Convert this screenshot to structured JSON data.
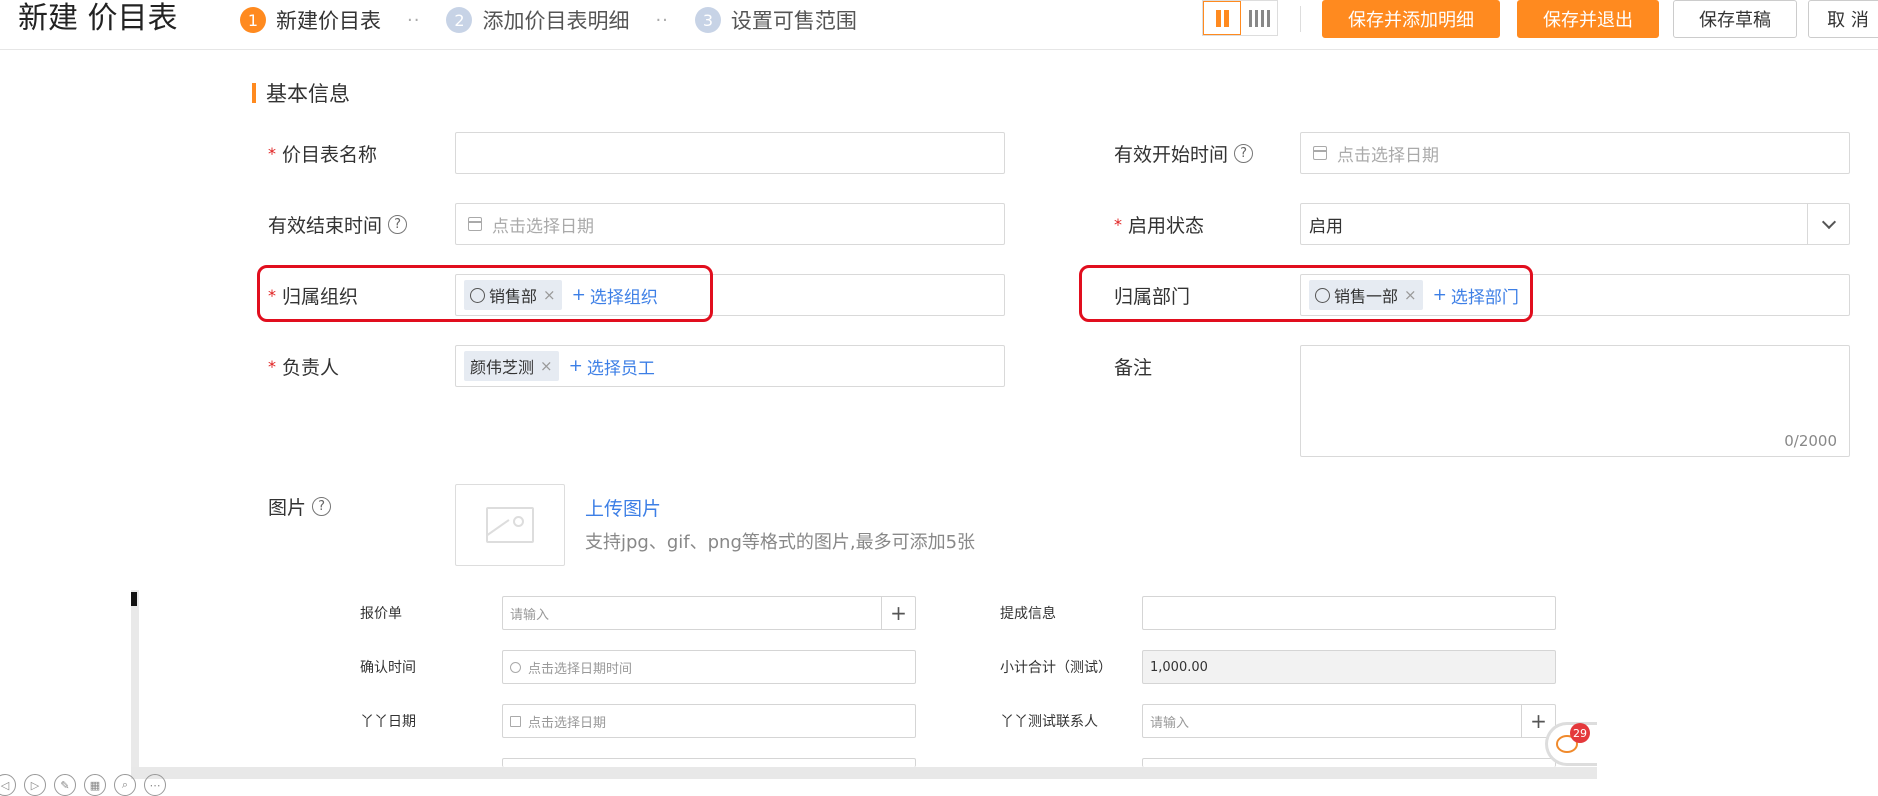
{
  "header": {
    "title": "新建 价目表",
    "steps": [
      {
        "num": "1",
        "label": "新建价目表"
      },
      {
        "num": "2",
        "label": "添加价目表明细"
      },
      {
        "num": "3",
        "label": "设置可售范围"
      }
    ],
    "step_sep": "··",
    "buttons": {
      "save_add_detail": "保存并添加明细",
      "save_exit": "保存并退出",
      "save_draft": "保存草稿",
      "cancel": "取 消"
    }
  },
  "section": {
    "title": "基本信息"
  },
  "form": {
    "name_label": "价目表名称",
    "start_label": "有效开始时间",
    "start_placeholder": "点击选择日期",
    "end_label": "有效结束时间",
    "end_placeholder": "点击选择日期",
    "status_label": "启用状态",
    "status_value": "启用",
    "org_label": "归属组织",
    "org_tag": "销售部",
    "org_add": "选择组织",
    "dept_label": "归属部门",
    "dept_tag": "销售一部",
    "dept_add": "选择部门",
    "owner_label": "负责人",
    "owner_tag": "颜伟芝测",
    "owner_add": "选择员工",
    "remark_label": "备注",
    "remark_counter": "0/2000",
    "image_label": "图片",
    "upload_link": "上传图片",
    "upload_hint": "支持jpg、gif、png等格式的图片,最多可添加5张",
    "required_mark": "*",
    "help_mark": "?",
    "remove_mark": "×",
    "add_mark": "+"
  },
  "panel": {
    "quote_label": "报价单",
    "quote_placeholder": "请输入",
    "submit_label": "提成信息",
    "confirm_label": "确认时间",
    "confirm_placeholder": "点击选择日期时间",
    "subtotal_label": "小计合计（测试）",
    "subtotal_value": "1,000.00",
    "yy_date_label": "丫丫日期",
    "yy_date_placeholder": "点击选择日期",
    "yy_contact_label": "丫丫测试联系人",
    "yy_contact_placeholder": "请输入",
    "plus": "+"
  },
  "chat": {
    "badge": "29"
  },
  "colors": {
    "accent": "#ff8a1f",
    "link": "#3d7fe6",
    "highlight": "#e10e1e"
  }
}
